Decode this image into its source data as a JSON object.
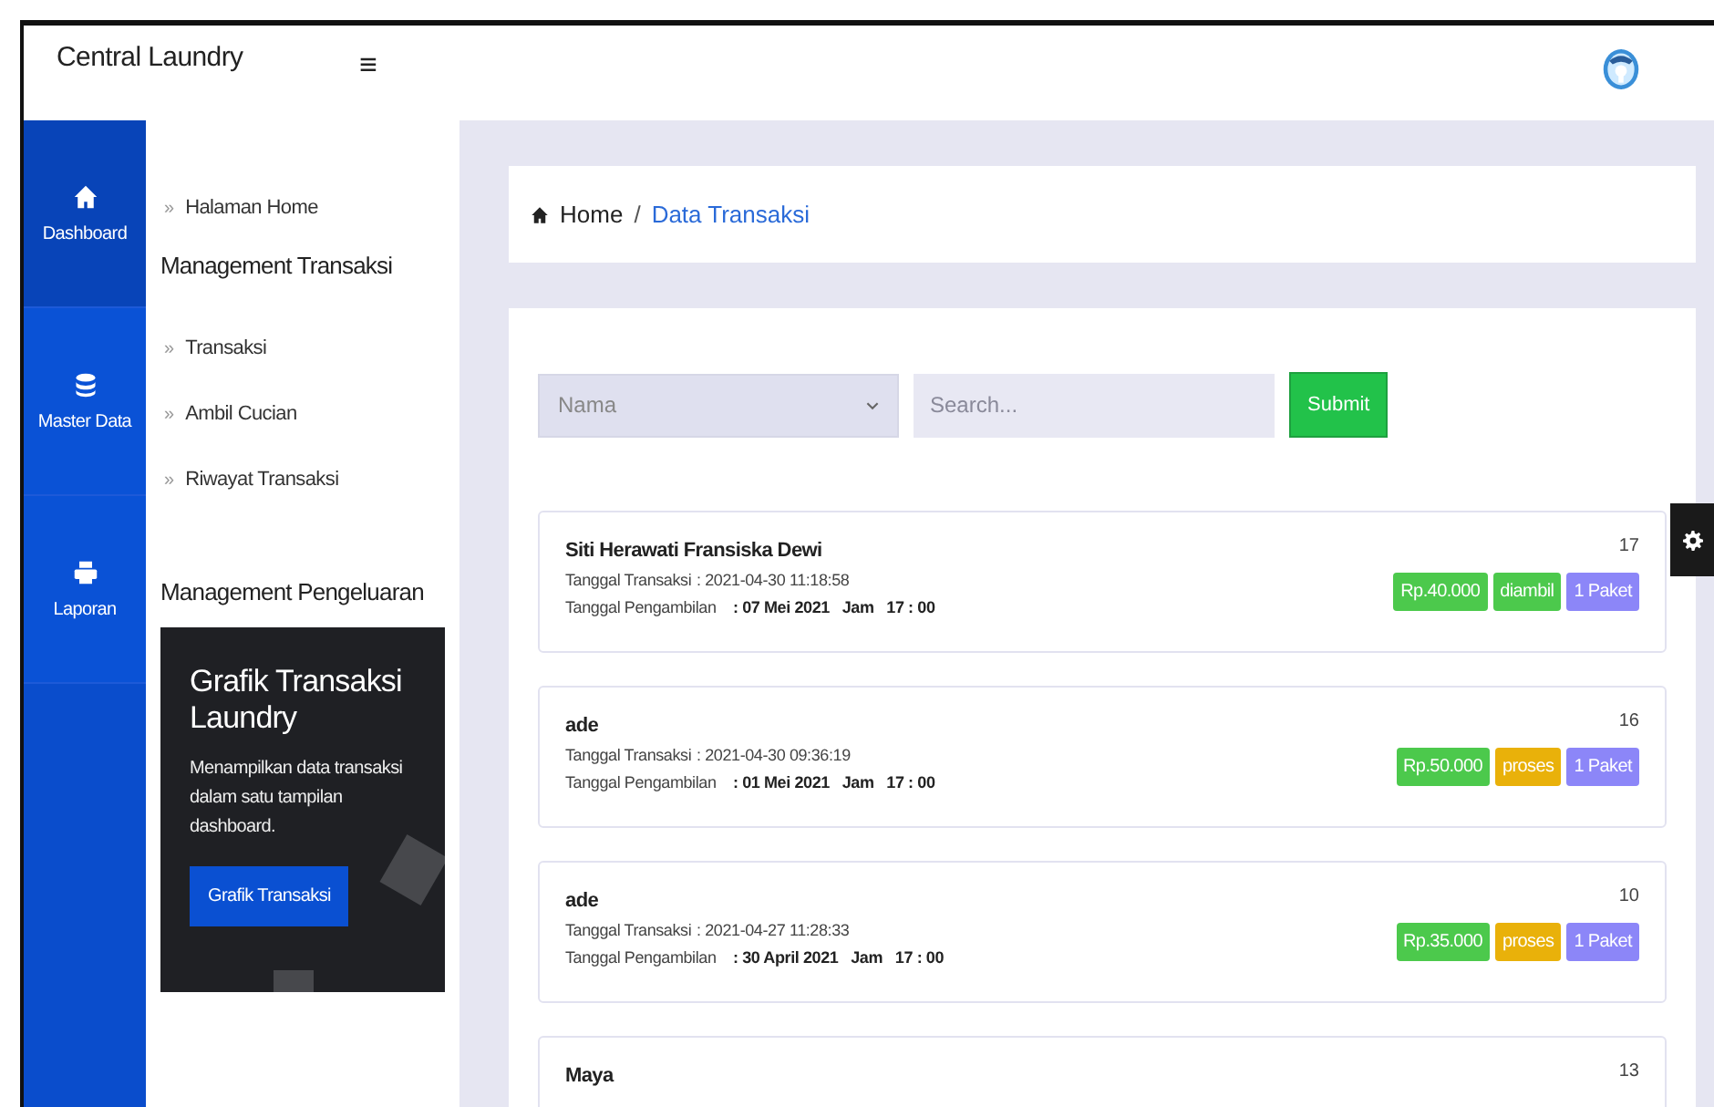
{
  "header": {
    "brand": "Central Laundry",
    "menu_glyph": "≡"
  },
  "rail": [
    {
      "label": "Dashboard",
      "kind": "home",
      "selected": true
    },
    {
      "label": "Master Data",
      "kind": "database",
      "selected": false
    },
    {
      "label": "Laporan",
      "kind": "printer",
      "selected": false
    }
  ],
  "sidebar": {
    "items": [
      {
        "kind": "link",
        "label": "Halaman Home",
        "bullet": "»"
      },
      {
        "kind": "heading",
        "label": "Management Transaksi"
      },
      {
        "kind": "link",
        "label": "Transaksi",
        "bullet": "»"
      },
      {
        "kind": "link",
        "label": "Ambil Cucian",
        "bullet": "»"
      },
      {
        "kind": "link",
        "label": "Riwayat Transaksi",
        "bullet": "»"
      },
      {
        "kind": "heading",
        "label": "Management Pengeluaran"
      }
    ],
    "promo": {
      "title": "Grafik Transaksi Laundry",
      "text": "Menampilkan data transaksi dalam satu tampilan dashboard.",
      "button": "Grafik Transaksi"
    }
  },
  "breadcrumb": [
    {
      "label": "Home",
      "selected": false
    },
    {
      "label": "Data Transaksi",
      "selected": true
    }
  ],
  "breadcrumb_separator": "/",
  "filter": {
    "select": "Nama",
    "search_placeholder": "Search...",
    "button": "Submit"
  },
  "transactions": [
    {
      "name": "Siti Herawati Fransiska Dewi",
      "number": "17",
      "tx_label": "Tanggal Transaksi",
      "tx_value": ": 2021-04-30 11:18:58",
      "pickup_label": "Tanggal Pengambilan",
      "pickup_value": ": 07 Mei 2021   Jam   17 : 00",
      "badges": [
        {
          "text": "Rp.40.000",
          "color": "#4cc94c"
        },
        {
          "text": "diambil",
          "color": "#4cc94c"
        },
        {
          "text": "1 Paket",
          "color": "#8c86f8"
        }
      ]
    },
    {
      "name": "ade",
      "number": "16",
      "tx_label": "Tanggal Transaksi",
      "tx_value": ": 2021-04-30 09:36:19",
      "pickup_label": "Tanggal Pengambilan",
      "pickup_value": ": 01 Mei 2021   Jam   17 : 00",
      "badges": [
        {
          "text": "Rp.50.000",
          "color": "#4cc94c"
        },
        {
          "text": "proses",
          "color": "#e9b10a"
        },
        {
          "text": "1 Paket",
          "color": "#8c86f8"
        }
      ]
    },
    {
      "name": "ade",
      "number": "10",
      "tx_label": "Tanggal Transaksi",
      "tx_value": ": 2021-04-27 11:28:33",
      "pickup_label": "Tanggal Pengambilan",
      "pickup_value": ": 30 April 2021   Jam   17 : 00",
      "badges": [
        {
          "text": "Rp.35.000",
          "color": "#4cc94c"
        },
        {
          "text": "proses",
          "color": "#e9b10a"
        },
        {
          "text": "1 Paket",
          "color": "#8c86f8"
        }
      ]
    },
    {
      "name": "Maya",
      "number": "13"
    }
  ]
}
